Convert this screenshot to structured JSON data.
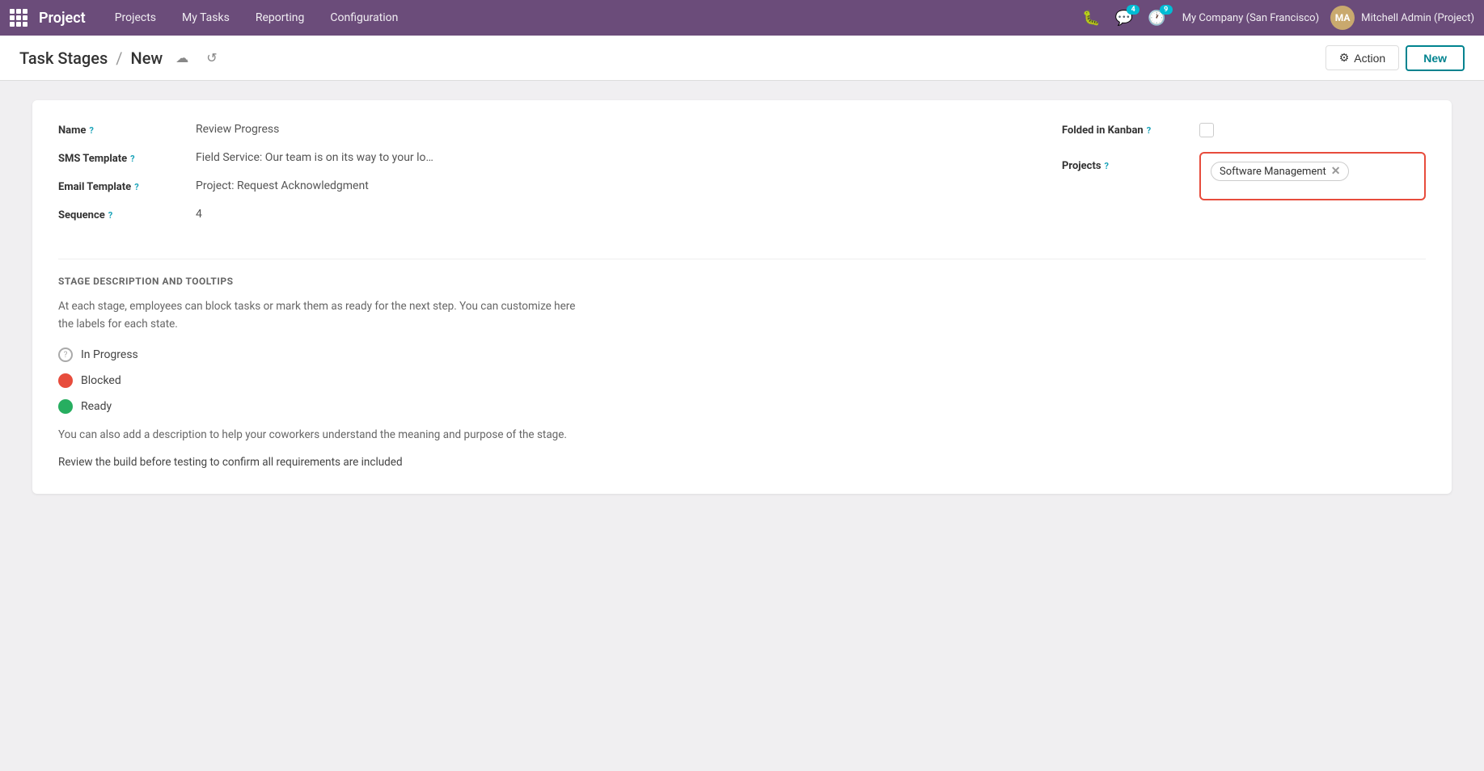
{
  "app": {
    "title": "Project",
    "nav_items": [
      "Projects",
      "My Tasks",
      "Reporting",
      "Configuration"
    ],
    "company": "My Company (San Francisco)",
    "user": "Mitchell Admin (Project)",
    "badge_messages": "4",
    "badge_activity": "9"
  },
  "breadcrumb": {
    "parent": "Task Stages",
    "separator": "/",
    "current": "New",
    "action_label": "Action",
    "new_label": "New"
  },
  "form": {
    "name_label": "Name",
    "name_value": "Review Progress",
    "sms_label": "SMS Template",
    "sms_value": "Field Service: Our team is on its way to your lo…",
    "email_label": "Email Template",
    "email_value": "Project: Request Acknowledgment",
    "sequence_label": "Sequence",
    "sequence_value": "4",
    "folded_label": "Folded in Kanban",
    "projects_label": "Projects",
    "project_tag": "Software Management"
  },
  "section": {
    "title": "STAGE DESCRIPTION AND TOOLTIPS",
    "description": "At each stage, employees can block tasks or mark them as ready for the next step. You can customize here the labels for each state.",
    "state_in_progress": "In Progress",
    "state_blocked": "Blocked",
    "state_ready": "Ready",
    "description2": "You can also add a description to help your coworkers understand the meaning and purpose of the stage.",
    "stage_desc": "Review the build before testing to confirm all requirements are included"
  },
  "icons": {
    "grid": "⊞",
    "upload": "☁",
    "refresh": "↺",
    "gear": "⚙",
    "bug": "🐛",
    "question_mark": "?"
  }
}
